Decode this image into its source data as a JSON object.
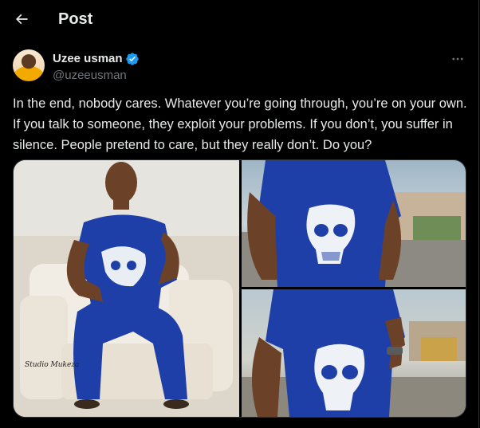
{
  "header": {
    "title": "Post",
    "back_icon": "arrow-left-icon"
  },
  "author": {
    "name": "Uzee usman",
    "handle": "@uzeeusman",
    "verified_color": "#1d9bf0"
  },
  "tweet": {
    "text": "In the end, nobody cares. Whatever you’re going through, you’re on your own. If you talk to someone, they exploit your problems. If you don’t, you suffer in silence. People pretend to care, but they really don’t. Do you?"
  },
  "media": {
    "photo_count": 3,
    "signature": "Studio Mukeza"
  },
  "colors": {
    "background": "#000000",
    "text": "#e7e9ea",
    "muted": "#71767b",
    "accent": "#1d9bf0"
  }
}
